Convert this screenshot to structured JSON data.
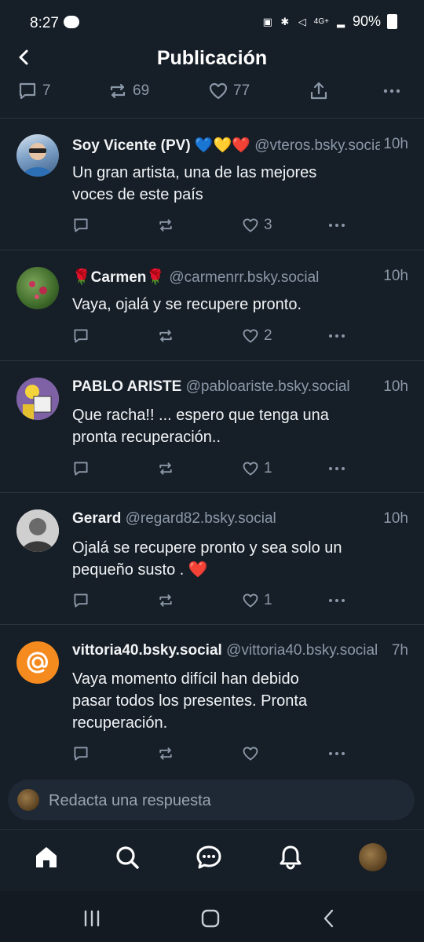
{
  "status_bar": {
    "time": "8:27",
    "network": "4G+",
    "battery": "90%"
  },
  "header": {
    "title": "Publicación"
  },
  "top_actions": {
    "replies": "7",
    "reposts": "69",
    "likes": "77"
  },
  "posts": [
    {
      "author": "Soy Vicente (PV) 💙💛❤️",
      "handle": "@vteros.bsky.social",
      "time": "10h",
      "lines": [
        "Un gran artista, una de las mejores",
        "voces de este país"
      ],
      "likes": "3"
    },
    {
      "author": "🌹Carmen🌹",
      "handle": "@carmenrr.bsky.social",
      "time": "10h",
      "lines": [
        "Vaya, ojalá y se recupere pronto."
      ],
      "likes": "2"
    },
    {
      "author": "PABLO ARISTE",
      "handle": "@pabloariste.bsky.social",
      "time": "10h",
      "lines": [
        "Que racha!! ... espero que tenga una",
        "pronta recuperación.."
      ],
      "likes": "1"
    },
    {
      "author": "Gerard",
      "handle": "@regard82.bsky.social",
      "time": "10h",
      "lines": [
        "Ojalá se recupere pronto y sea solo un",
        "pequeño susto . ❤️"
      ],
      "likes": "1"
    },
    {
      "author": "vittoria40.bsky.social",
      "handle": "@vittoria40.bsky.social",
      "time": "7h",
      "lines": [
        "Vaya momento difícil han debido",
        "pasar todos los presentes. Pronta",
        "recuperación."
      ],
      "likes": ""
    }
  ],
  "reply_box": {
    "placeholder": "Redacta una respuesta"
  },
  "colors": {
    "background": "#161e27",
    "muted": "#8b98a8",
    "text": "#f1f3f5",
    "avatar_orange": "#f58a1f"
  }
}
